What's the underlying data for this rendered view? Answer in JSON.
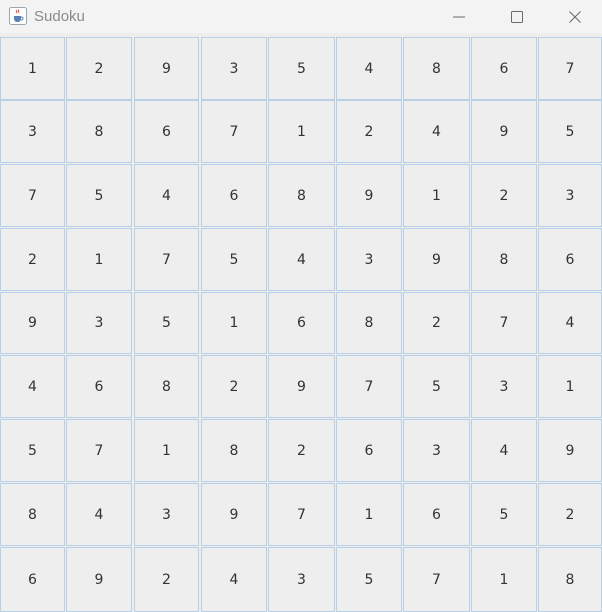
{
  "window": {
    "title": "Sudoku",
    "app_icon": "java-cup-icon",
    "controls": {
      "minimize_icon": "minimize-icon",
      "maximize_icon": "maximize-icon",
      "close_icon": "close-icon"
    }
  },
  "board": {
    "rows": [
      [
        "1",
        "2",
        "9",
        "3",
        "5",
        "4",
        "8",
        "6",
        "7"
      ],
      [
        "3",
        "8",
        "6",
        "7",
        "1",
        "2",
        "4",
        "9",
        "5"
      ],
      [
        "7",
        "5",
        "4",
        "6",
        "8",
        "9",
        "1",
        "2",
        "3"
      ],
      [
        "2",
        "1",
        "7",
        "5",
        "4",
        "3",
        "9",
        "8",
        "6"
      ],
      [
        "9",
        "3",
        "5",
        "1",
        "6",
        "8",
        "2",
        "7",
        "4"
      ],
      [
        "4",
        "6",
        "8",
        "2",
        "9",
        "7",
        "5",
        "3",
        "1"
      ],
      [
        "5",
        "7",
        "1",
        "8",
        "2",
        "6",
        "3",
        "4",
        "9"
      ],
      [
        "8",
        "4",
        "3",
        "9",
        "7",
        "1",
        "6",
        "5",
        "2"
      ],
      [
        "6",
        "9",
        "2",
        "4",
        "3",
        "5",
        "7",
        "1",
        "8"
      ]
    ]
  },
  "colors": {
    "cell_background": "#eeeeee",
    "cell_border": "#b8cfe5",
    "title_text": "#8a8a8a"
  }
}
